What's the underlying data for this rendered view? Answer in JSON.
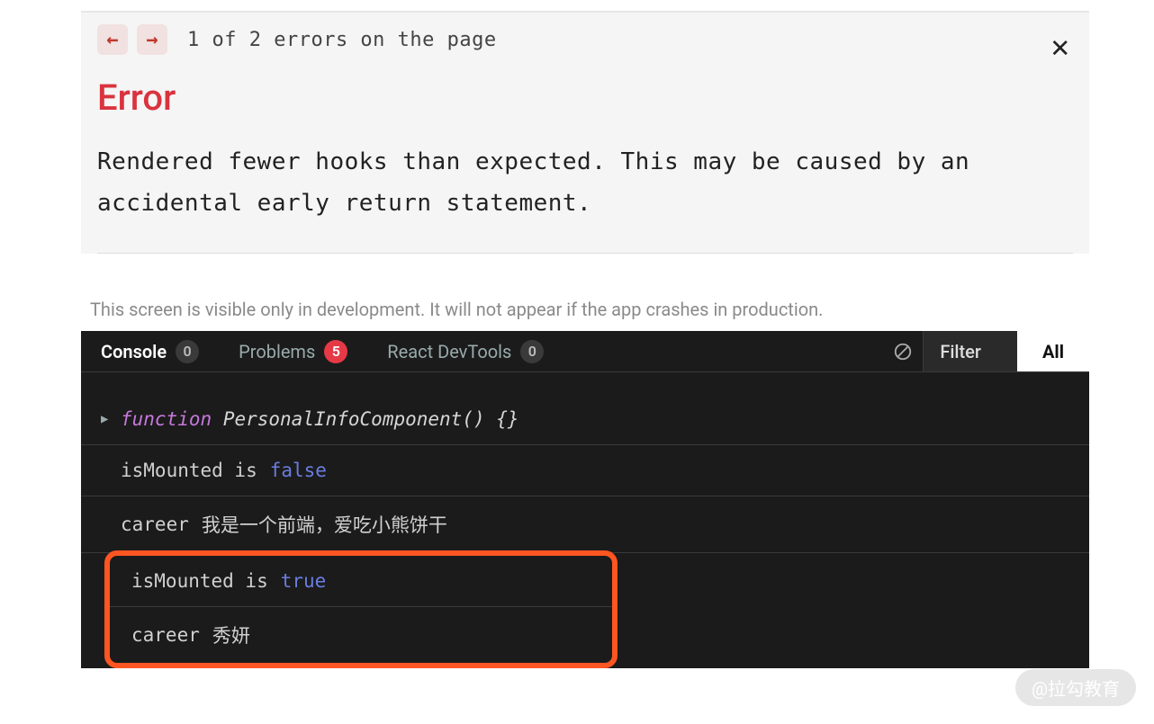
{
  "overlay": {
    "nav": {
      "prev_glyph": "←",
      "next_glyph": "→",
      "counter": "1 of 2 errors on the page",
      "close_glyph": "✕"
    },
    "title": "Error",
    "message": "Rendered fewer hooks than expected. This may be caused by an accidental early return statement.",
    "dev_note": "This screen is visible only in development. It will not appear if the app crashes in production."
  },
  "devtools": {
    "tabs": [
      {
        "label": "Console",
        "badge": "0",
        "badge_kind": "grey",
        "active": true
      },
      {
        "label": "Problems",
        "badge": "5",
        "badge_kind": "red",
        "active": false
      },
      {
        "label": "React DevTools",
        "badge": "0",
        "badge_kind": "grey",
        "active": false
      }
    ],
    "filter_label": "Filter",
    "level_label": "All"
  },
  "logs": {
    "row0": {
      "keyword": "function",
      "name": "PersonalInfoComponent() {}"
    },
    "row1": {
      "label": "isMounted is",
      "value": "false"
    },
    "row2": {
      "label": "career",
      "value": "我是一个前端，爱吃小熊饼干"
    },
    "row3": {
      "label": "isMounted is",
      "value": "true"
    },
    "row4": {
      "label": "career",
      "value": "秀妍"
    }
  },
  "watermark": "@拉勾教育"
}
